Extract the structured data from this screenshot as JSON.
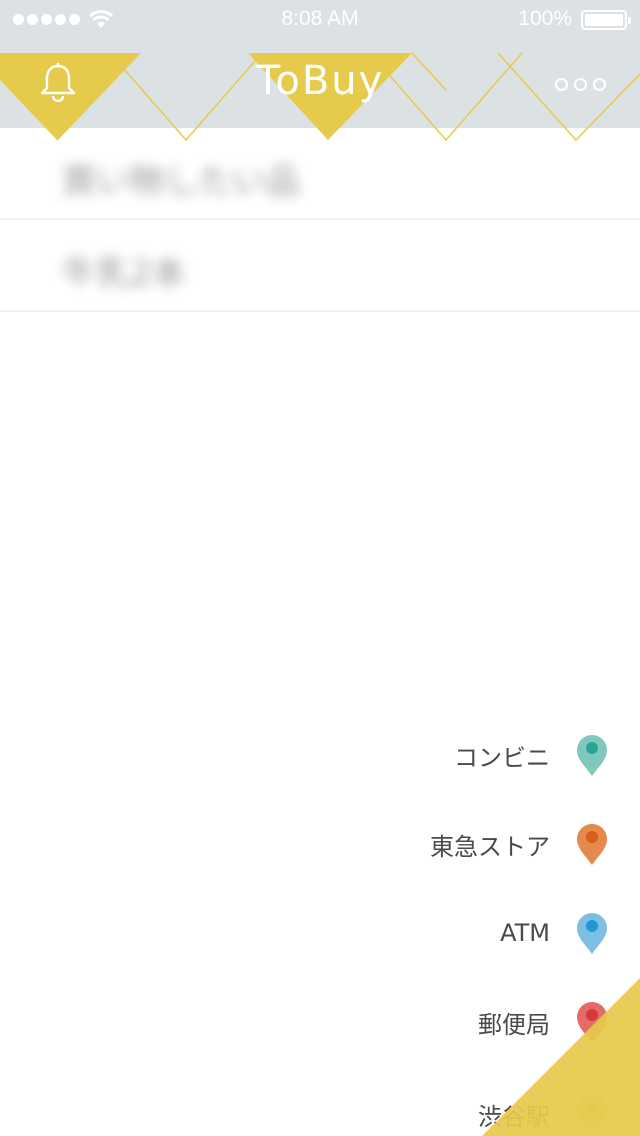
{
  "status_bar": {
    "time": "8:08 AM",
    "battery": "100%",
    "signal_dots": 5
  },
  "nav": {
    "title": "ToBuy",
    "left_icon": "bell-icon",
    "right_icon": "more-dots-icon",
    "accent_color": "#e6ca4c",
    "background_color": "#dce1e3"
  },
  "list": {
    "items": [
      {
        "label": "買い物したい品"
      },
      {
        "label": "牛乳2本"
      }
    ]
  },
  "places": {
    "items": [
      {
        "label": "コンビニ",
        "icon": "map-pin-icon",
        "color": "#7ec8be",
        "dot": "#2aa397"
      },
      {
        "label": "東急ストア",
        "icon": "map-pin-icon",
        "color": "#e48a4c",
        "dot": "#d6601c"
      },
      {
        "label": "ATM",
        "icon": "map-pin-icon",
        "color": "#7dbfe0",
        "dot": "#1f98d4"
      },
      {
        "label": "郵便局",
        "icon": "map-pin-icon",
        "color": "#e36b68",
        "dot": "#d43a3a"
      },
      {
        "label": "渋谷駅",
        "icon": "map-pin-icon",
        "color": "#d9a640",
        "dot": "#c48a1c"
      }
    ]
  },
  "scroll_top": {
    "icon": "arrow-up-icon",
    "color": "#e6ca4c"
  }
}
